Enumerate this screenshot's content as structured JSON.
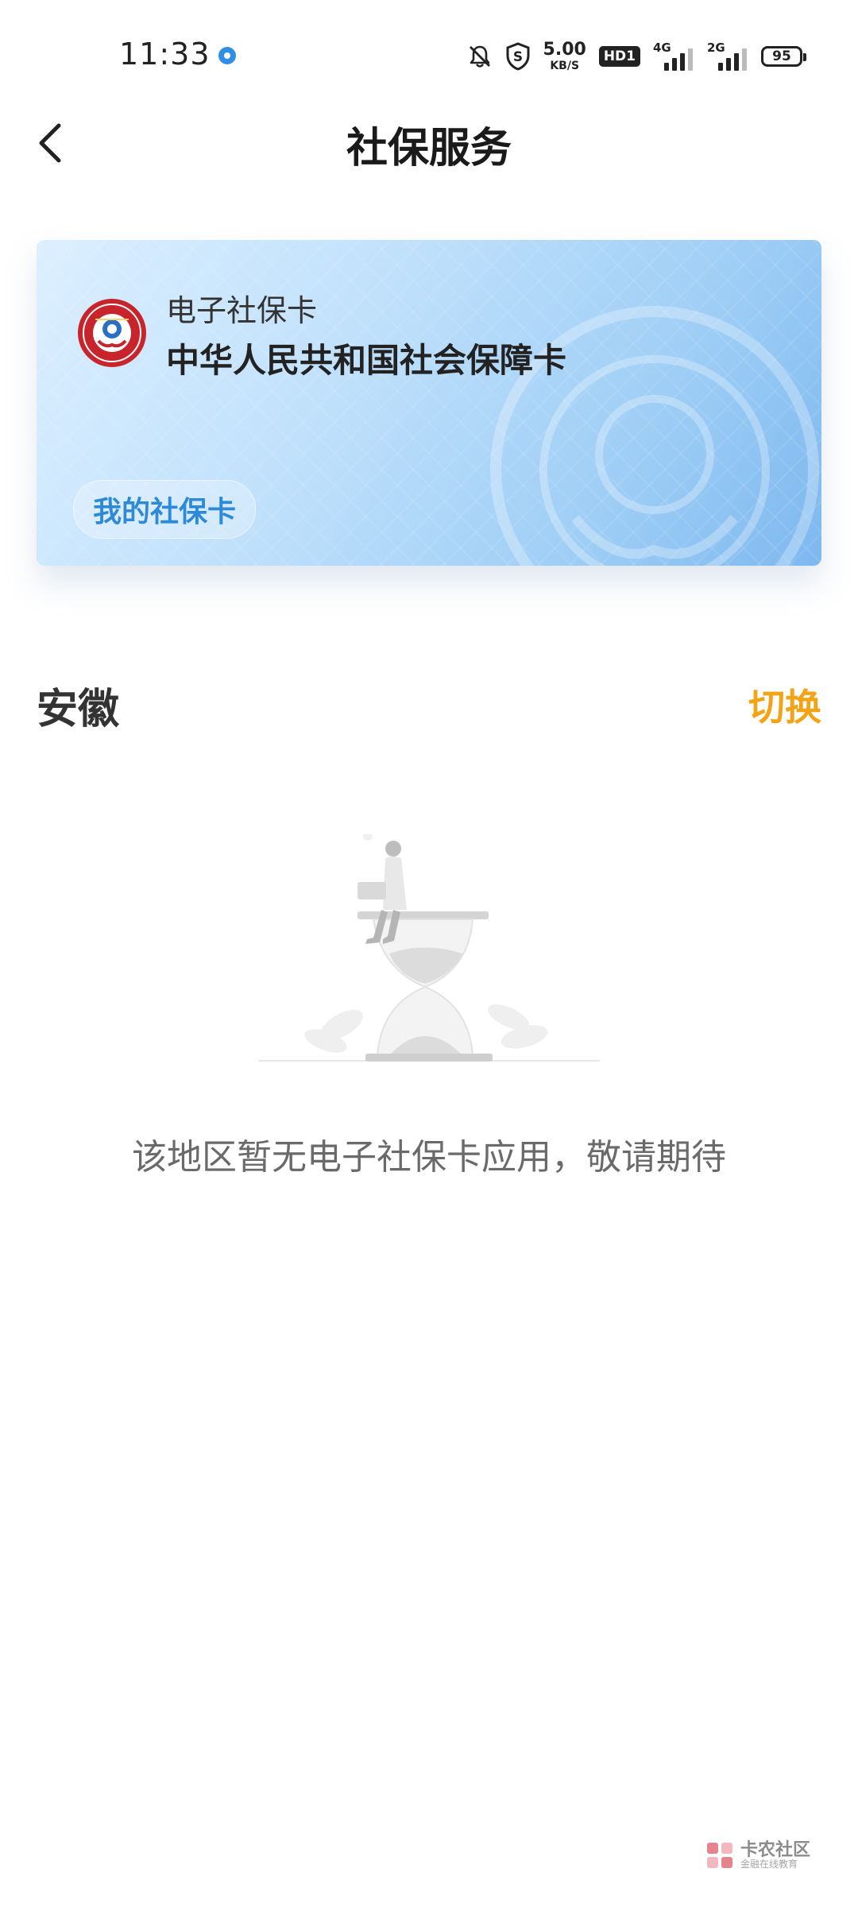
{
  "status_bar": {
    "time": "11:33",
    "speed_value": "5.00",
    "speed_unit": "KB/S",
    "hd_label": "HD1",
    "network1": "4G",
    "network2": "2G",
    "battery": "95"
  },
  "header": {
    "title": "社保服务"
  },
  "card": {
    "subtitle": "电子社保卡",
    "title": "中华人民共和国社会保障卡",
    "button_label": "我的社保卡"
  },
  "region": {
    "name": "安徽",
    "switch_label": "切换"
  },
  "empty_state": {
    "message": "该地区暂无电子社保卡应用，敬请期待"
  },
  "watermark": {
    "name": "卡农社区",
    "tagline": "金融在线教育"
  },
  "colors": {
    "accent_blue": "#2e8ad8",
    "switch_orange": "#f2a316",
    "card_gradient_end": "#7db8ef"
  }
}
